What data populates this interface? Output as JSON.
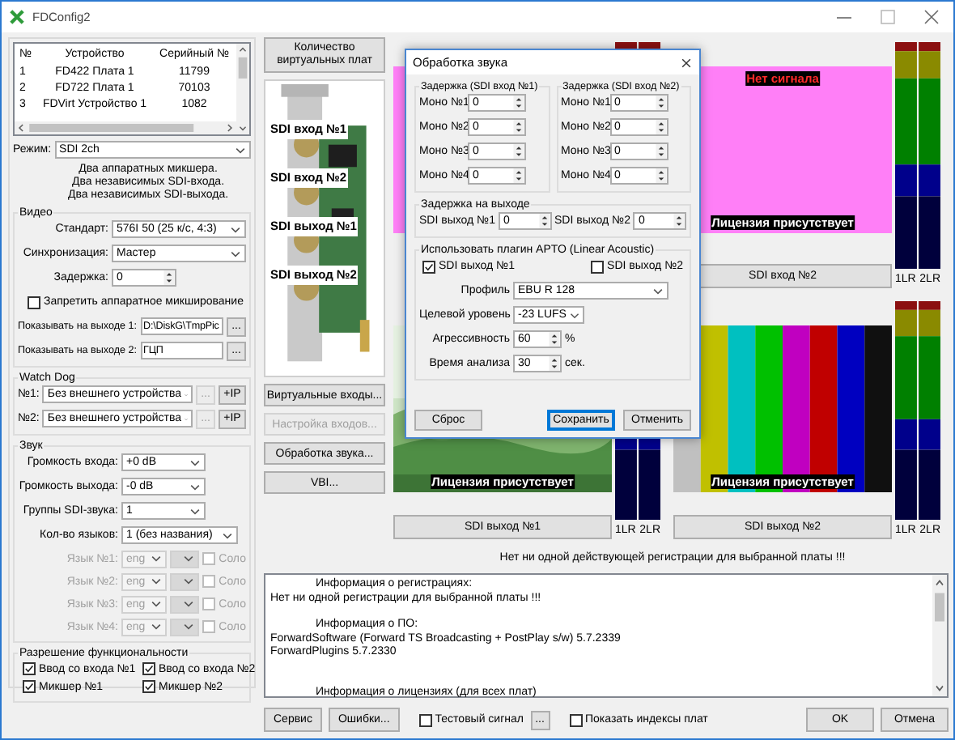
{
  "window": {
    "title": "FDConfig2"
  },
  "devices": {
    "columns": [
      "№",
      "Устройство",
      "Серийный №"
    ],
    "rows": [
      [
        "1",
        "FD422 Плата 1",
        "11799"
      ],
      [
        "2",
        "FD722 Плата 1",
        "70103"
      ],
      [
        "3",
        "FDVirt Устройство 1",
        "1082"
      ]
    ]
  },
  "mode": {
    "label": "Режим:",
    "value": "SDI 2ch",
    "description": [
      "Два аппаратных микшера.",
      "Два независимых SDI-входа.",
      "Два независимых SDI-выхода."
    ]
  },
  "video": {
    "title": "Видео",
    "standard": {
      "label": "Стандарт:",
      "value": "576I 50 (25 к/с, 4:3)"
    },
    "sync": {
      "label": "Синхронизация:",
      "value": "Мастер"
    },
    "delay": {
      "label": "Задержка:",
      "value": "0"
    },
    "disable_mixing": {
      "label": "Запретить аппаратное микширование",
      "checked": false
    },
    "outputs": [
      {
        "label": "Показывать на выходе 1:",
        "value": "D:\\DiskG\\TmpPic",
        "button": "..."
      },
      {
        "label": "Показывать на выходе 2:",
        "value": "ГЦП",
        "button": "..."
      }
    ]
  },
  "watchdog": {
    "title": "Watch Dog",
    "rows": [
      {
        "label": "№1:",
        "value": "Без внешнего устройства",
        "more": "...",
        "more_disabled": true,
        "ip": "+IP"
      },
      {
        "label": "№2:",
        "value": "Без внешнего устройства",
        "more": "...",
        "more_disabled": true,
        "ip": "+IP"
      }
    ]
  },
  "sound": {
    "title": "Звук",
    "fields": [
      {
        "label": "Громкость входа:",
        "value": "+0 dB",
        "kind": "short"
      },
      {
        "label": "Громкость выхода:",
        "value": "-0 dB",
        "kind": "short"
      },
      {
        "label": "Группы SDI-звука:",
        "value": "1",
        "kind": "short"
      },
      {
        "label": "Кол-во языков:",
        "value": "1 (без названия)",
        "kind": "wide"
      }
    ],
    "languages": [
      {
        "label": "Язык №1:",
        "value": "eng",
        "solo": "Соло",
        "checked": false,
        "disabled": true
      },
      {
        "label": "Язык №2:",
        "value": "eng",
        "solo": "Соло",
        "checked": false,
        "disabled": true
      },
      {
        "label": "Язык №3:",
        "value": "eng",
        "solo": "Соло",
        "checked": false,
        "disabled": true
      },
      {
        "label": "Язык №4:",
        "value": "eng",
        "solo": "Соло",
        "checked": false,
        "disabled": true
      }
    ]
  },
  "features": {
    "title": "Разрешение функциональности",
    "items": [
      {
        "label": "Ввод со входа №1",
        "checked": true
      },
      {
        "label": "Ввод со входа №2",
        "checked": true
      },
      {
        "label": "Микшер №1",
        "checked": true
      },
      {
        "label": "Микшер №2",
        "checked": true
      }
    ]
  },
  "card": {
    "button": "Количество виртуальных плат",
    "labels": [
      "SDI вход №1",
      "SDI вход №2",
      "SDI выход №1",
      "SDI выход №2"
    ],
    "buttons": [
      {
        "label": "Виртуальные входы...",
        "disabled": false
      },
      {
        "label": "Настройка входов...",
        "disabled": true
      },
      {
        "label": "Обработка звука...",
        "disabled": false
      },
      {
        "label": "VBI...",
        "disabled": false
      }
    ]
  },
  "previews": [
    {
      "kind": "no_signal"
    },
    {
      "kind": "no_signal",
      "status": "Нет сигнала",
      "license": "Лицензия присутствует",
      "button": "SDI вход №2",
      "meter_labels": [
        "1LR",
        "2LR"
      ]
    },
    {
      "kind": "video",
      "license": "Лицензия присутствует",
      "button": "SDI выход №1",
      "meter_labels": [
        "1LR",
        "2LR"
      ]
    },
    {
      "kind": "color_bars",
      "license": "Лицензия присутствует",
      "button": "SDI выход №2",
      "meter_labels": [
        "1LR",
        "2LR"
      ]
    }
  ],
  "registration_message": "Нет ни одной действующей регистрации для выбранной платы !!!",
  "log": [
    {
      "kind": "heading",
      "text": "Информация о регистрациях:"
    },
    {
      "kind": "line",
      "text": "Нет ни одной регистрации для выбранной платы !!!"
    },
    {
      "kind": "heading",
      "text": "Информация о ПО:"
    },
    {
      "kind": "line",
      "text": "ForwardSoftware (Forward TS Broadcasting + PostPlay s/w) 5.7.2339"
    },
    {
      "kind": "line",
      "text": "ForwardPlugins 5.7.2330"
    },
    {
      "kind": "heading_far",
      "text": "Информация о лицензиях (для всех плат)"
    }
  ],
  "bottom": {
    "buttons": [
      "Сервис",
      "Ошибки..."
    ],
    "test_signal": {
      "label": "Тестовый сигнал",
      "checked": false,
      "button": "..."
    },
    "show_indexes": {
      "label": "Показать индексы плат",
      "checked": false
    },
    "ok": "OK",
    "cancel": "Отмена"
  },
  "dialog": {
    "title": "Обработка звука",
    "delay_groups": [
      {
        "title": "Задержка (SDI вход №1)",
        "rows": [
          {
            "label": "Моно №1",
            "value": "0"
          },
          {
            "label": "Моно №2",
            "value": "0"
          },
          {
            "label": "Моно №3",
            "value": "0"
          },
          {
            "label": "Моно №4",
            "value": "0"
          }
        ]
      },
      {
        "title": "Задержка (SDI вход №2)",
        "rows": [
          {
            "label": "Моно №1",
            "value": "0"
          },
          {
            "label": "Моно №2",
            "value": "0"
          },
          {
            "label": "Моно №3",
            "value": "0"
          },
          {
            "label": "Моно №4",
            "value": "0"
          }
        ]
      }
    ],
    "output_delay": {
      "title": "Задержка на выходе",
      "rows": [
        {
          "label": "SDI выход №1",
          "value": "0"
        },
        {
          "label": "SDI выход №2",
          "value": "0"
        }
      ]
    },
    "apto": {
      "title": "Использовать плагин APTO (Linear Acoustic)",
      "outputs": [
        {
          "label": "SDI выход №1",
          "checked": true
        },
        {
          "label": "SDI выход №2",
          "checked": false
        }
      ],
      "profile": {
        "label": "Профиль",
        "value": "EBU R 128"
      },
      "target": {
        "label": "Целевой уровень",
        "value": "-23 LUFS"
      },
      "aggressiveness": {
        "label": "Агрессивность",
        "value": "60",
        "unit": "%"
      },
      "analysis_time": {
        "label": "Время анализа",
        "value": "30",
        "unit": "сек."
      }
    },
    "buttons": [
      {
        "label": "Сброс",
        "default": false
      },
      {
        "label": "Сохранить",
        "default": true
      },
      {
        "label": "Отменить",
        "default": false
      }
    ]
  }
}
